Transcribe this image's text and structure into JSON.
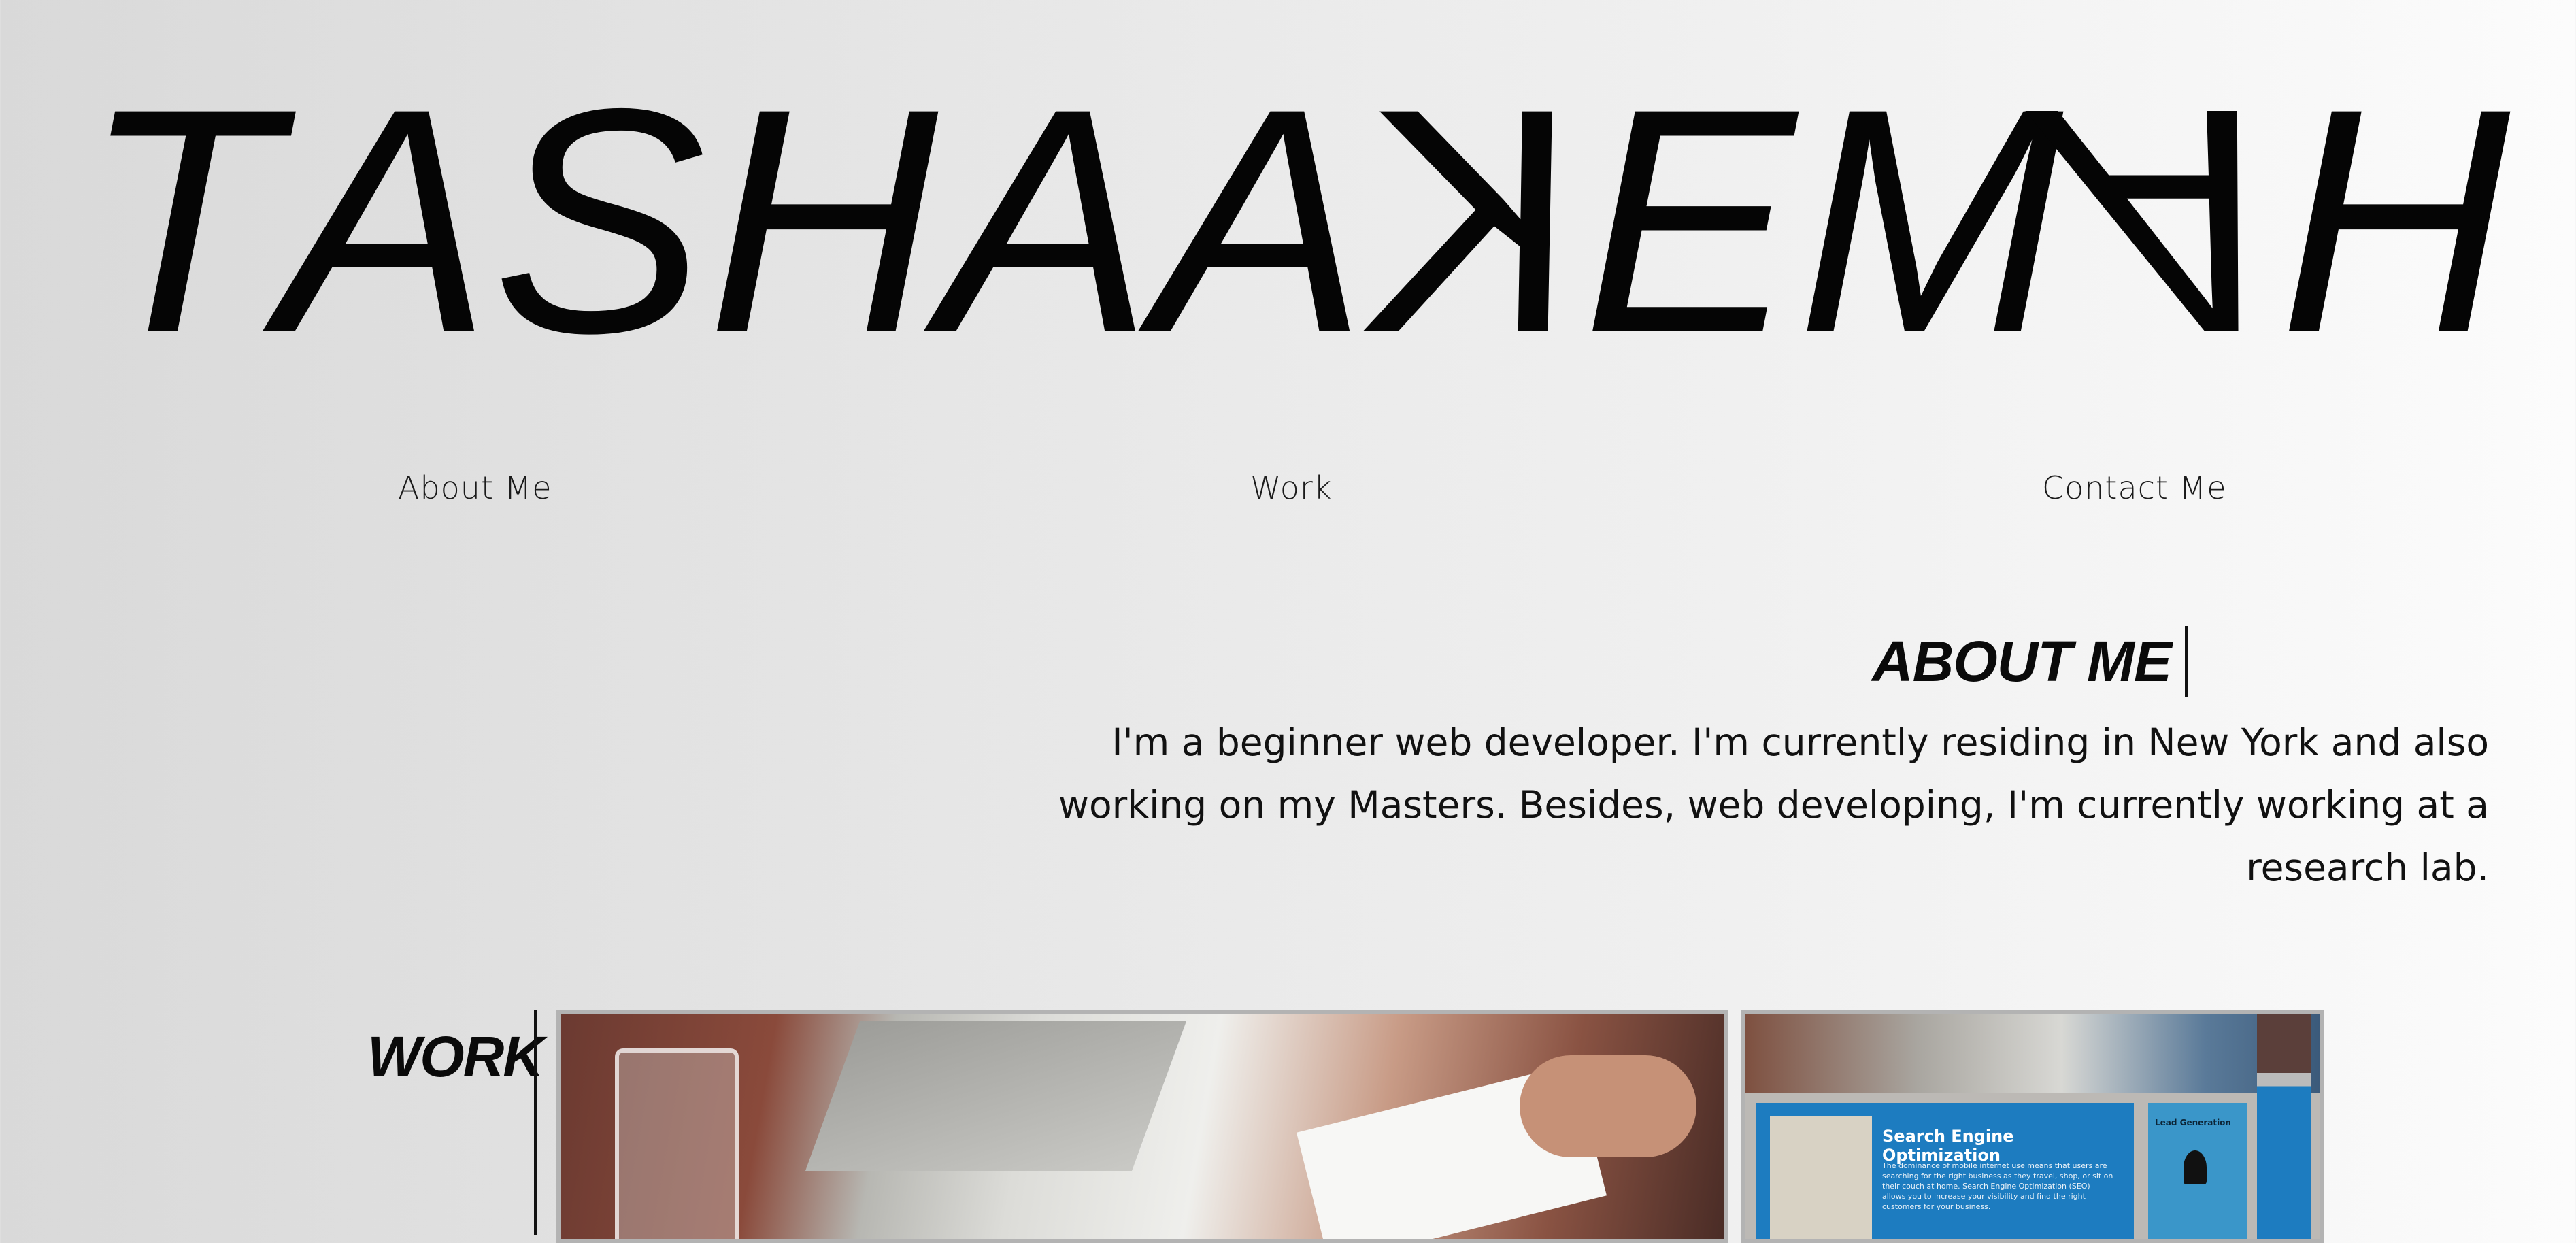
{
  "logo": {
    "letters": [
      "T",
      "A",
      "S",
      "H",
      "A",
      "A",
      "K",
      "E",
      "M",
      "A",
      "H"
    ]
  },
  "nav": {
    "about": "About Me",
    "work": "Work",
    "contact": "Contact Me"
  },
  "about": {
    "title": "ABOUT ME",
    "text": "I'm a beginner web developer. I'm currently residing in New York and also working on my Masters. Besides, web developing, I'm currently working at a research lab."
  },
  "work": {
    "title": "WORK",
    "card2_heading": "Search Engine Optimization",
    "card2_body": "The dominance of mobile internet use means that users are searching for the right business as they travel, shop, or sit on their couch at home. Search Engine Optimization (SEO) allows you to increase your visibility and find the right customers for your business.",
    "card2_side_title": "Lead Generation"
  },
  "colors": {
    "text": "#0a0a0a",
    "card_border": "#b3b3b3",
    "seo_blue": "#1d7cc0"
  }
}
